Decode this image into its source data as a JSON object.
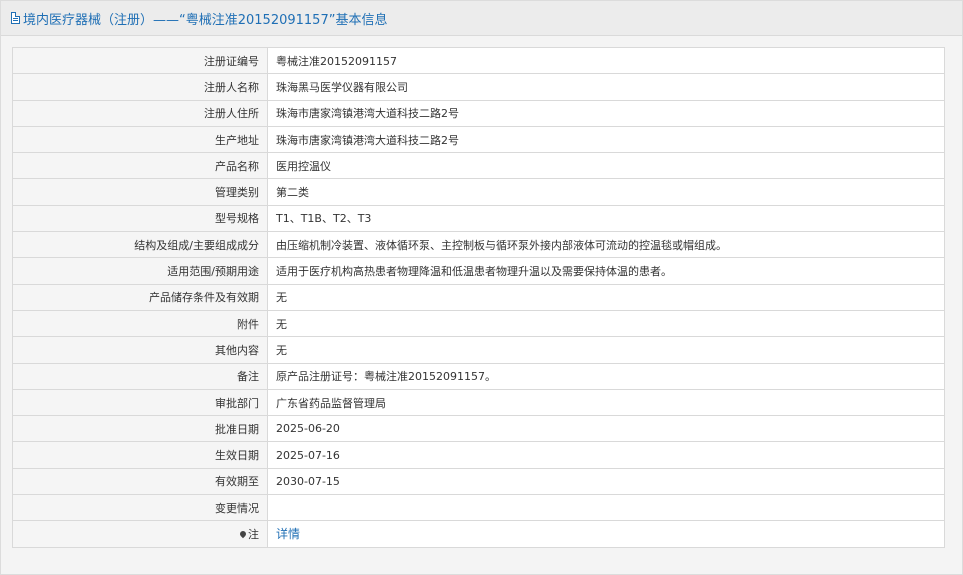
{
  "header": {
    "icon": "document-icon",
    "title": "境内医疗器械（注册）——“粤械注准20152091157”基本信息"
  },
  "rows": [
    {
      "label": "注册证编号",
      "value": "粤械注准20152091157"
    },
    {
      "label": "注册人名称",
      "value": "珠海黑马医学仪器有限公司"
    },
    {
      "label": "注册人住所",
      "value": "珠海市唐家湾镇港湾大道科技二路2号"
    },
    {
      "label": "生产地址",
      "value": "珠海市唐家湾镇港湾大道科技二路2号"
    },
    {
      "label": "产品名称",
      "value": "医用控温仪"
    },
    {
      "label": "管理类别",
      "value": "第二类"
    },
    {
      "label": "型号规格",
      "value": "T1、T1B、T2、T3"
    },
    {
      "label": "结构及组成/主要组成成分",
      "value": "由压缩机制冷装置、液体循环泵、主控制板与循环泵外接内部液体可流动的控温毯或帽组成。"
    },
    {
      "label": "适用范围/预期用途",
      "value": "适用于医疗机构高热患者物理降温和低温患者物理升温以及需要保持体温的患者。"
    },
    {
      "label": "产品储存条件及有效期",
      "value": "无"
    },
    {
      "label": "附件",
      "value": "无"
    },
    {
      "label": "其他内容",
      "value": "无"
    },
    {
      "label": "备注",
      "value": "原产品注册证号：粤械注准20152091157。"
    },
    {
      "label": "审批部门",
      "value": "广东省药品监督管理局"
    },
    {
      "label": "批准日期",
      "value": "2025-06-20"
    },
    {
      "label": "生效日期",
      "value": "2025-07-16"
    },
    {
      "label": "有效期至",
      "value": "2030-07-15"
    },
    {
      "label": "变更情况",
      "value": ""
    }
  ],
  "note": {
    "icon": "pin-icon",
    "label": "注",
    "link_text": "详情"
  }
}
